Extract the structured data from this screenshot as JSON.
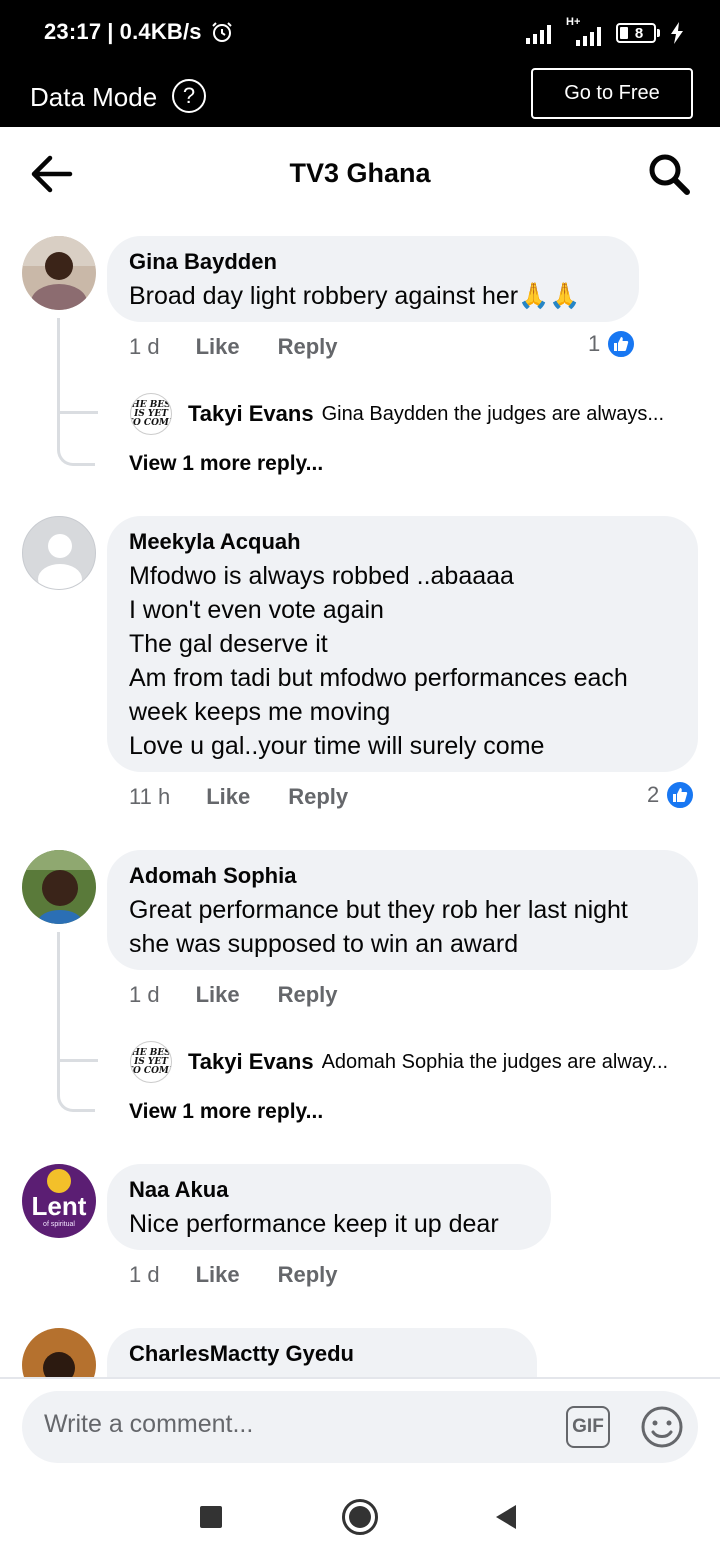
{
  "status_bar": {
    "time": "23:17",
    "speed": "0.4KB/s",
    "network": "H+",
    "battery": "8"
  },
  "data_bar": {
    "title": "Data Mode",
    "help_glyph": "?",
    "free_button": "Go to Free"
  },
  "header": {
    "title": "TV3 Ghana"
  },
  "comments": [
    {
      "author": "Gina Baydden",
      "lines": [
        "Broad day light robbery against her🙏🙏"
      ],
      "time": "1 d",
      "like": "Like",
      "reply": "Reply",
      "reactions": "1",
      "replies": {
        "author": "Takyi Evans",
        "text": "Gina Baydden the judges are always...",
        "view_more": "View 1 more reply..."
      }
    },
    {
      "author": "Meekyla Acquah",
      "lines": [
        "Mfodwo is always robbed ..abaaaa",
        "I won't even vote again",
        "The gal deserve it",
        "Am from tadi but mfodwo performances each",
        "week keeps me moving",
        "Love u gal..your time will surely come"
      ],
      "time": "11 h",
      "like": "Like",
      "reply": "Reply",
      "reactions": "2"
    },
    {
      "author": "Adomah Sophia",
      "lines": [
        "Great performance but they rob her last night",
        "she was supposed to win an award"
      ],
      "time": "1 d",
      "like": "Like",
      "reply": "Reply",
      "replies": {
        "author": "Takyi Evans",
        "text": "Adomah Sophia the judges are alway...",
        "view_more": "View 1 more reply..."
      }
    },
    {
      "author": "Naa Akua",
      "lines": [
        "Nice performance keep it up dear"
      ],
      "time": "1 d",
      "like": "Like",
      "reply": "Reply",
      "avatar_text": "Lent",
      "avatar_subtext": "of spiritual"
    },
    {
      "author": "CharlesMactty Gyedu",
      "lines": []
    }
  ],
  "reply_avatar_text": [
    "THE BEST",
    "IS YET",
    "TO COME"
  ],
  "composer": {
    "placeholder": "Write a comment...",
    "gif_label": "GIF"
  },
  "colors": {
    "accent": "#1877f2",
    "bubble": "#f0f2f5",
    "secondary_text": "#65676b"
  },
  "icons": [
    "back-arrow-icon",
    "search-icon",
    "help-icon",
    "alarm-icon",
    "signal-icon",
    "battery-icon",
    "like-icon",
    "gif-icon",
    "emoji-icon"
  ]
}
